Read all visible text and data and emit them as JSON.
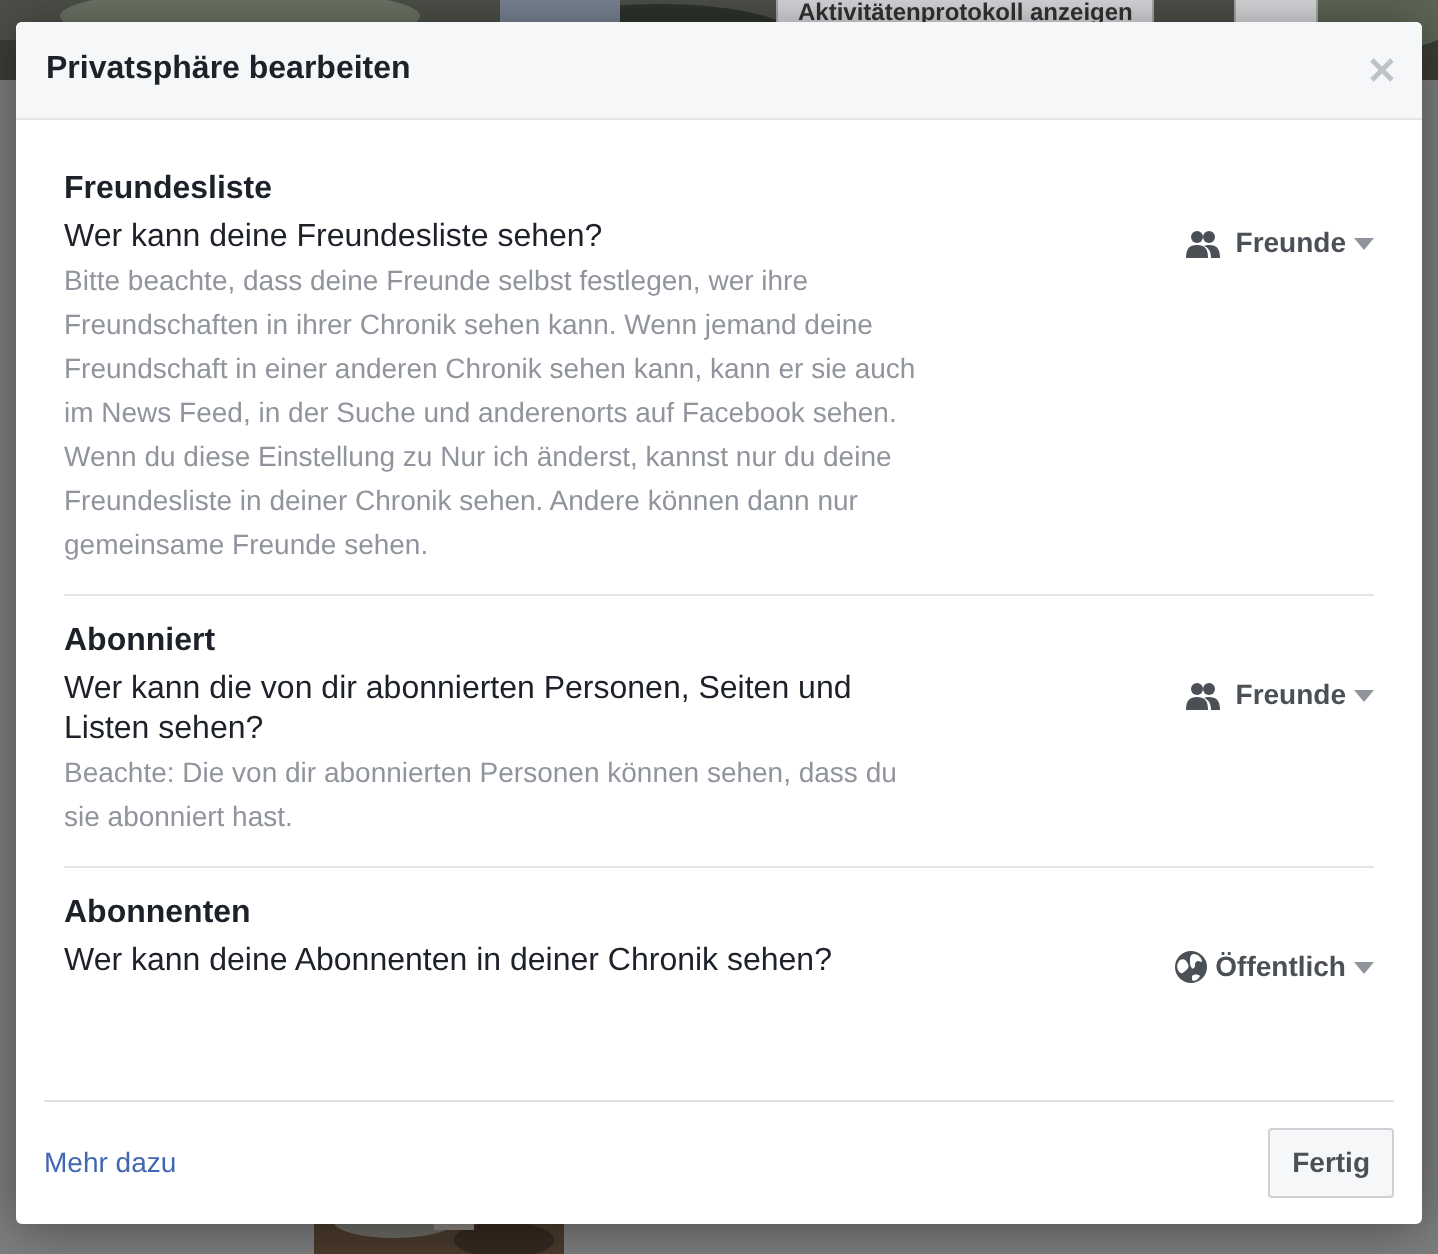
{
  "background": {
    "activity_button": "Aktivitätenprotokoll anzeigen"
  },
  "dialog": {
    "title": "Privatsphäre bearbeiten",
    "sections": [
      {
        "heading": "Freundesliste",
        "question": "Wer kann deine Freundesliste sehen?",
        "description": "Bitte beachte, dass deine Freunde selbst festlegen, wer ihre Freundschaften in ihrer Chronik sehen kann. Wenn jemand deine Freundschaft in einer anderen Chronik sehen kann, kann er sie auch im News Feed, in der Suche und anderenorts auf Facebook sehen. Wenn du diese Einstellung zu Nur ich änderst, kannst nur du deine Freundesliste in deiner Chronik sehen. Andere können dann nur gemeinsame Freunde sehen.",
        "audience": {
          "kind": "friends",
          "label": "Freunde"
        }
      },
      {
        "heading": "Abonniert",
        "question": "Wer kann die von dir abonnierten Personen, Seiten und Listen sehen?",
        "description": "Beachte: Die von dir abonnierten Personen können sehen, dass du sie abonniert hast.",
        "audience": {
          "kind": "friends",
          "label": "Freunde"
        }
      },
      {
        "heading": "Abonnenten",
        "question": "Wer kann deine Abonnenten in deiner Chronik sehen?",
        "audience": {
          "kind": "public",
          "label": "Öffentlich"
        }
      }
    ],
    "footer": {
      "link": "Mehr dazu",
      "button": "Fertig"
    }
  }
}
